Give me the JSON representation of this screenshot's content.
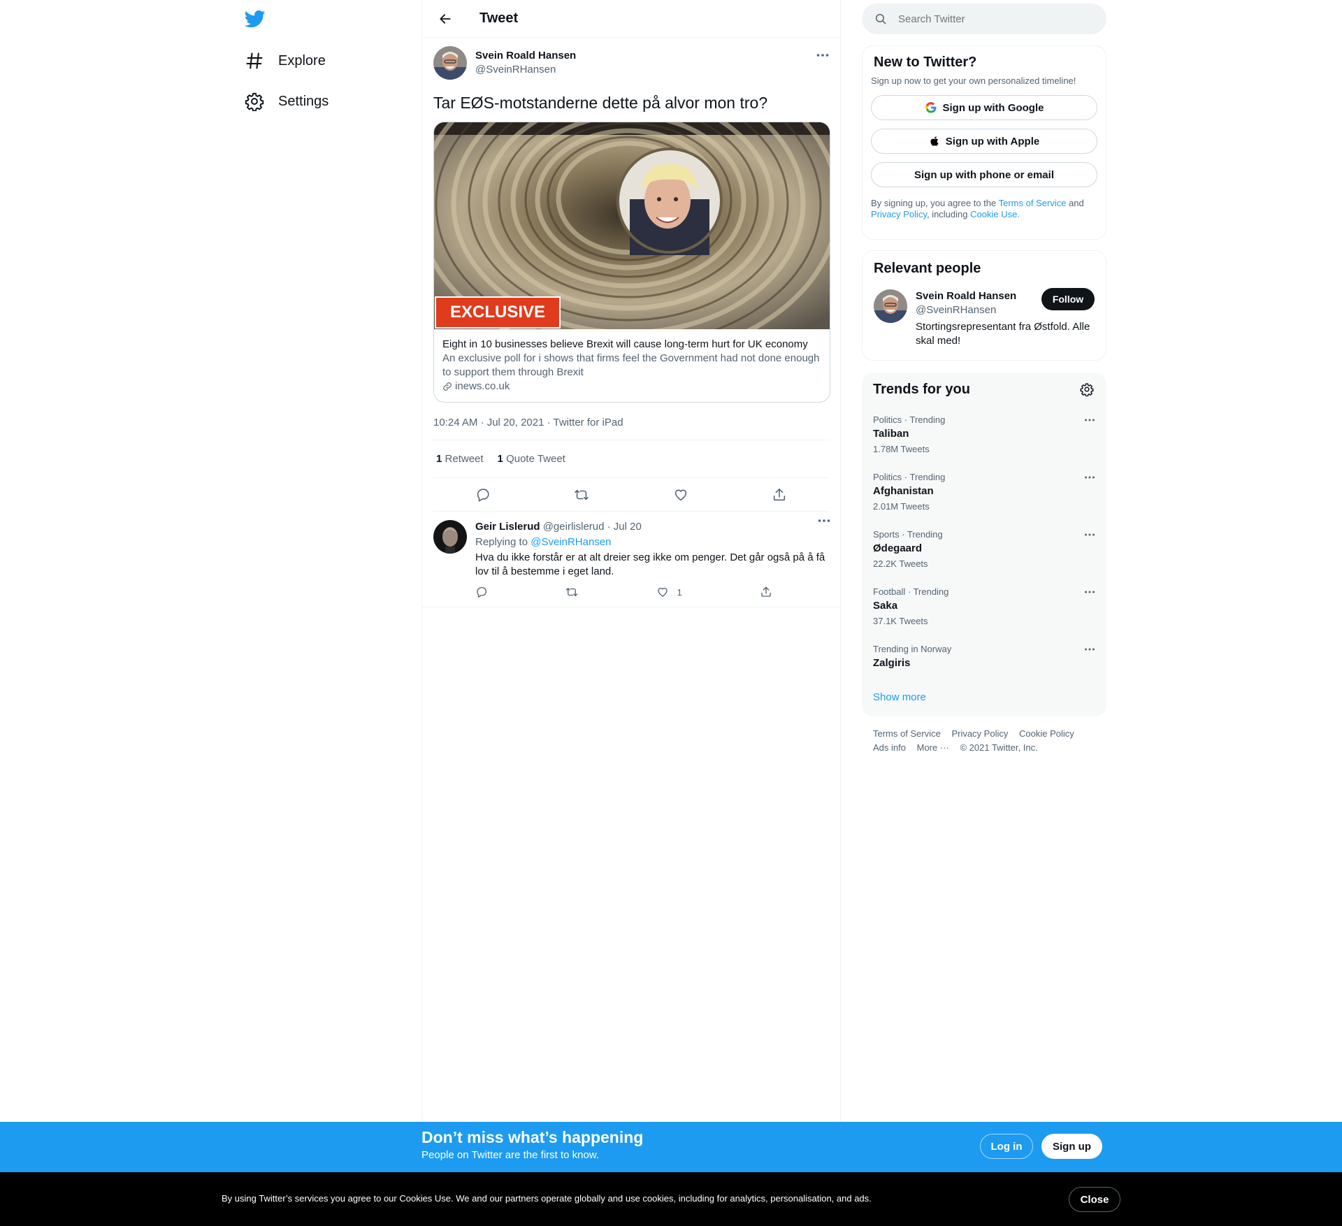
{
  "nav": {
    "items": [
      {
        "label": "Explore",
        "icon": "hashtag-icon"
      },
      {
        "label": "Settings",
        "icon": "gear-icon"
      }
    ]
  },
  "header": {
    "title": "Tweet"
  },
  "tweet": {
    "author_name": "Svein Roald Hansen",
    "author_handle": "@SveinRHansen",
    "text": "Tar EØS-motstanderne dette på alvor mon tro?",
    "card": {
      "badge": "EXCLUSIVE",
      "title": "Eight in 10 businesses believe Brexit will cause long-term hurt for UK economy",
      "description": "An exclusive poll for i shows that firms feel the Government had not done enough to support them through Brexit",
      "domain": "inews.co.uk"
    },
    "meta": "10:24 AM · Jul 20, 2021 · Twitter for iPad",
    "retweets": "1",
    "retweets_label": "Retweet",
    "quotes": "1",
    "quotes_label": "Quote Tweet"
  },
  "reply": {
    "name": "Geir Lislerud",
    "handle": "@geirlislerud",
    "date": "· Jul 20",
    "replying_prefix": "Replying to",
    "replying_to": "@SveinRHansen",
    "text": "Hva du ikke forstår er at alt dreier seg ikke om penger. Det går også på å få lov til å bestemme i eget land.",
    "likes": "1"
  },
  "search": {
    "placeholder": "Search Twitter"
  },
  "signup_panel": {
    "title": "New to Twitter?",
    "subtitle": "Sign up now to get your own personalized timeline!",
    "google": "Sign up with Google",
    "apple": "Sign up with Apple",
    "phone": "Sign up with phone or email",
    "legal_1": "By signing up, you agree to the",
    "terms": "Terms of Service",
    "legal_and": "and",
    "privacy": "Privacy Policy",
    "legal_including": ", including",
    "cookie": "Cookie Use."
  },
  "relevant": {
    "title": "Relevant people",
    "name": "Svein Roald Hansen",
    "handle": "@SveinRHansen",
    "follow": "Follow",
    "bio": "Stortingsrepresentant fra Østfold. Alle skal med!"
  },
  "trends": {
    "title": "Trends for you",
    "items": [
      {
        "meta": "Politics · Trending",
        "name": "Taliban",
        "count": "1.78M Tweets"
      },
      {
        "meta": "Politics · Trending",
        "name": "Afghanistan",
        "count": "2.01M Tweets"
      },
      {
        "meta": "Sports · Trending",
        "name": "Ødegaard",
        "count": "22.2K Tweets"
      },
      {
        "meta": "Football · Trending",
        "name": "Saka",
        "count": "37.1K Tweets"
      },
      {
        "meta": "Trending in Norway",
        "name": "Zalgiris",
        "count": ""
      }
    ],
    "show_more": "Show more"
  },
  "footer": {
    "terms": "Terms of Service",
    "privacy": "Privacy Policy",
    "cookie": "Cookie Policy",
    "ads": "Ads info",
    "more": "More ···",
    "copyright": "© 2021 Twitter, Inc."
  },
  "signup_bar": {
    "title": "Don’t miss what’s happening",
    "subtitle": "People on Twitter are the first to know.",
    "login": "Log in",
    "signup": "Sign up"
  },
  "cookie_bar": {
    "text": "By using Twitter’s services you agree to our Cookies Use. We and our partners operate globally and use cookies, including for analytics, personalisation, and ads.",
    "close": "Close"
  },
  "colors": {
    "accent": "#1d9bf0",
    "text": "#0f1419",
    "muted": "#536471",
    "badge": "#e03b1c"
  }
}
